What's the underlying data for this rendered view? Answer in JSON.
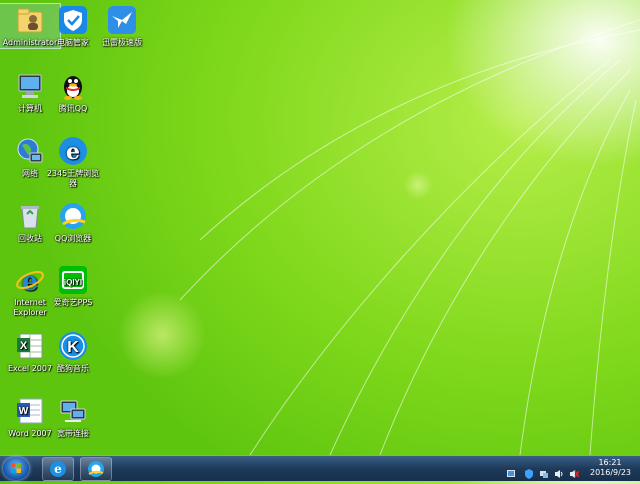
{
  "desktop": {
    "icons": [
      {
        "label": "Administrator"
      },
      {
        "label": "电脑管家"
      },
      {
        "label": "迅雷极速版"
      },
      {
        "label": "计算机"
      },
      {
        "label": "腾讯QQ"
      },
      {
        "label": "网络"
      },
      {
        "label": "2345王牌浏览器"
      },
      {
        "label": "回收站"
      },
      {
        "label": "QQ浏览器"
      },
      {
        "label": "Internet Explorer"
      },
      {
        "label": "爱奇艺PPS"
      },
      {
        "label": "Excel 2007"
      },
      {
        "label": "酷狗音乐"
      },
      {
        "label": "Word 2007"
      },
      {
        "label": "宽带连接"
      }
    ]
  },
  "taskbar": {
    "clock_time": "16:21",
    "clock_date": "2016/9/23"
  },
  "colors": {
    "wallpaper": "#7fd81b",
    "taskbar": "#1e3a5a"
  }
}
